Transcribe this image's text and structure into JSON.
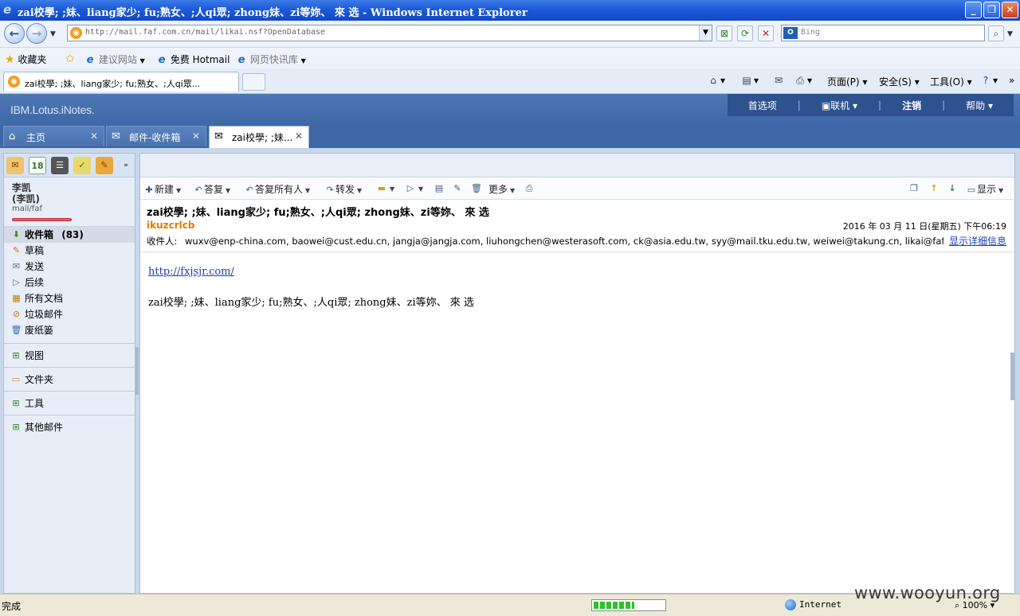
{
  "browser": {
    "window_title": "zai校學; ;妹、liang家少; fu;熟女、;人qi眾; zhong妹、zi等妳、 來 选 - Windows Internet Explorer",
    "url": "http://mail.faf.com.cn/mail/likai.nsf?OpenDatabase",
    "search_placeholder": "Bing",
    "favorites": {
      "favorites_label": "收藏夹",
      "suggested_sites": "建议网站",
      "hotmail": "免费 Hotmail",
      "web_slice": "网页快讯库"
    },
    "tab_title": "zai校學; ;妹、liang家少; fu;熟女、;人qi眾...",
    "commands": {
      "page": "页面(P)",
      "safety": "安全(S)",
      "tools": "工具(O)"
    },
    "status": {
      "left": "完成",
      "progress": 0.55,
      "zone": "Internet",
      "zoom": "100%"
    }
  },
  "lotus": {
    "brand": "IBM.Lotus.iNotes.",
    "menu": {
      "preferences": "首选项",
      "online": "联机",
      "logout": "注销",
      "help": "帮助"
    },
    "tabs": [
      {
        "label": "主页"
      },
      {
        "label": "邮件-收件箱"
      },
      {
        "label": "zai校學; ;妹..."
      }
    ],
    "user": {
      "name": "李凯",
      "alias": "(李凯)",
      "path": "mail/faf"
    },
    "folders": [
      {
        "label": "收件箱",
        "count": "(83)"
      },
      {
        "label": "草稿"
      },
      {
        "label": "发送"
      },
      {
        "label": "后续"
      },
      {
        "label": "所有文档"
      },
      {
        "label": "垃圾邮件"
      },
      {
        "label": "废纸篓"
      }
    ],
    "sections": {
      "views": "视图",
      "folders": "文件夹",
      "tools": "工具",
      "other_mail": "其他邮件"
    },
    "toolbar": {
      "new": "新建",
      "reply": "答复",
      "reply_all": "答复所有人",
      "forward": "转发",
      "more": "更多",
      "display": "显示"
    },
    "message": {
      "subject": "zai校學; ;妹、liang家少; fu;熟女、;人qi眾; zhong妹、zi等妳、 來 选",
      "sender": "ikuzcrlcb",
      "date": "2016 年 03 月 11 日(星期五) 下午06:19",
      "recipients_label": "收件人:",
      "recipients": "wuxv@enp-china.com, baowei@cust.edu.cn, jangja@jangja.com, liuhongchen@westerasoft.com, ck@asia.edu.tw, syy@mail.tku.edu.tw, weiwei@takung.cn, likai@faf.com....",
      "show_details": "显示详细信息",
      "link": "http://fxjsjr.com/",
      "body": "zai校學; ;妹、liang家少; fu;熟女、;人qi眾; zhong妹、zi等妳、 來 选"
    }
  },
  "watermark": "www.wooyun.org"
}
